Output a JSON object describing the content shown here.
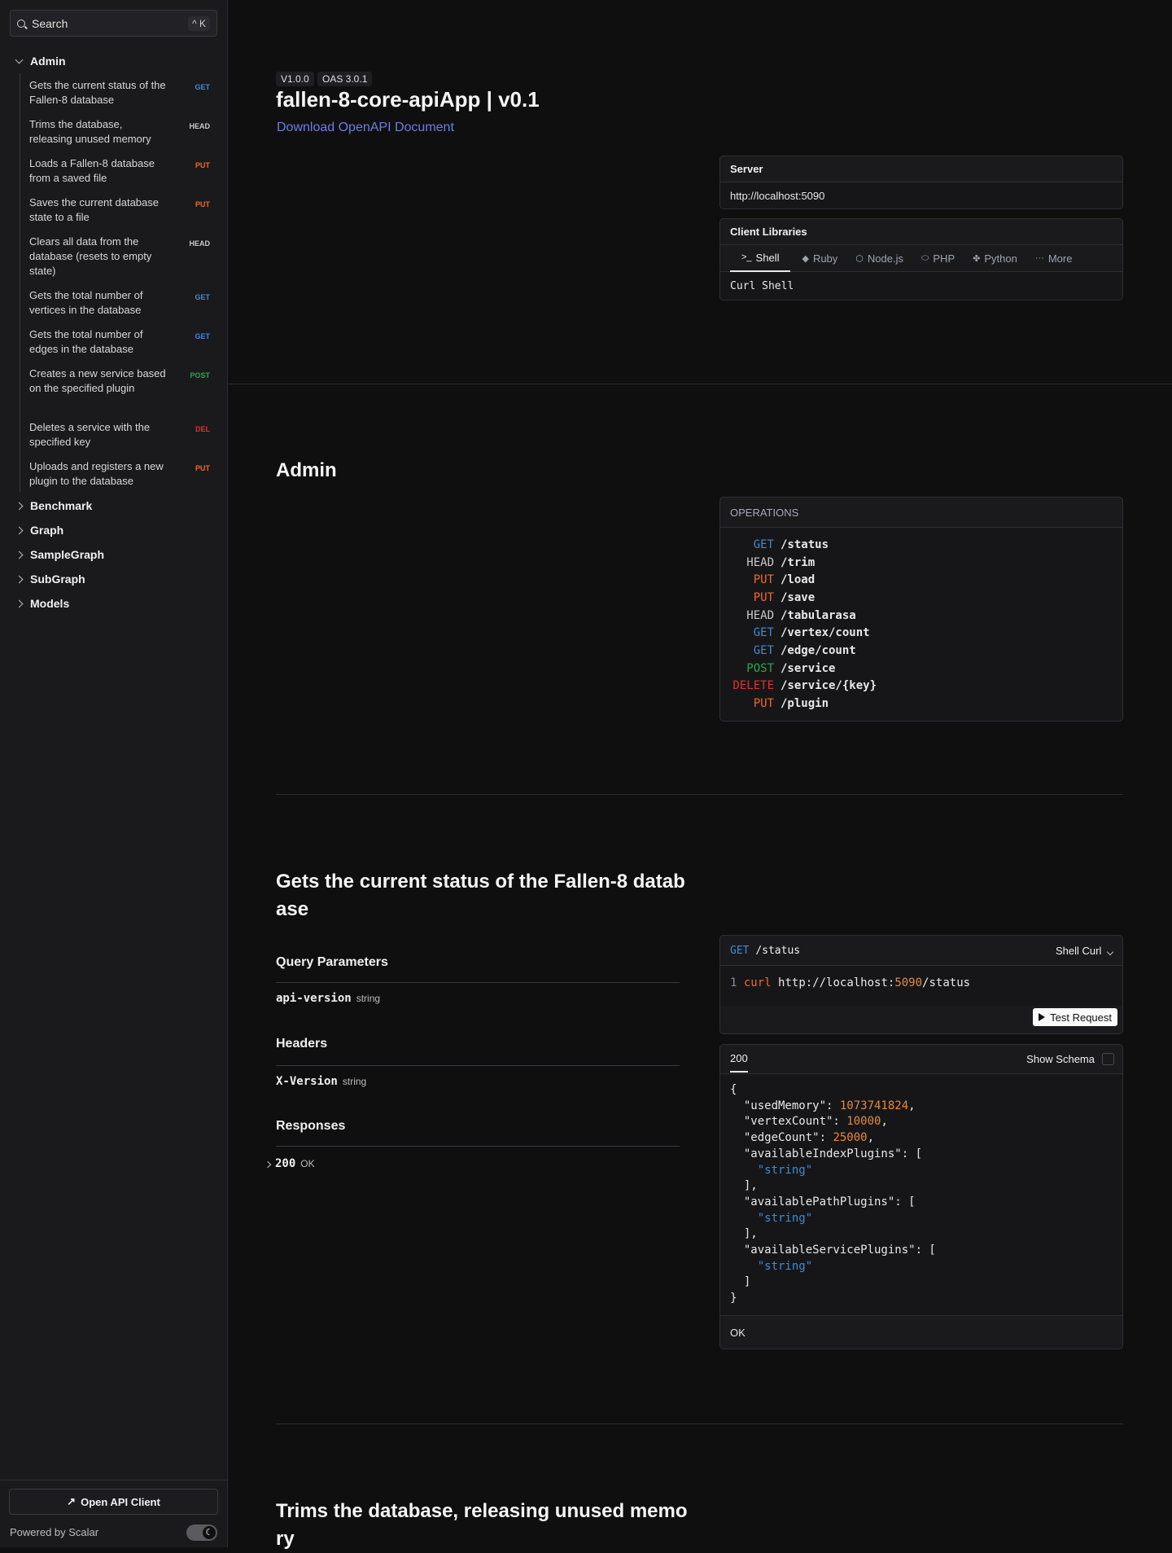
{
  "search": {
    "placeholder": "Search",
    "shortcut": "^ K"
  },
  "sidebar": {
    "admin_label": "Admin",
    "admin_items": [
      {
        "label": "Gets the current status of the Fallen-8 database",
        "method": "GET"
      },
      {
        "label": "Trims the database, releasing unused memory",
        "method": "HEAD"
      },
      {
        "label": "Loads a Fallen-8 database from a saved file",
        "method": "PUT"
      },
      {
        "label": "Saves the current database state to a file",
        "method": "PUT"
      },
      {
        "label": "Clears all data from the database (resets to empty state)",
        "method": "HEAD"
      },
      {
        "label": "Gets the total number of vertices in the database",
        "method": "GET"
      },
      {
        "label": "Gets the total number of edges in the database",
        "method": "GET"
      },
      {
        "label": "Creates a new service based on the specified plugin",
        "method": "POST"
      },
      {
        "label": "Deletes a service with the specified key",
        "method": "DEL"
      },
      {
        "label": "Uploads and registers a new plugin to the database",
        "method": "PUT"
      }
    ],
    "groups": [
      "Benchmark",
      "Graph",
      "SampleGraph",
      "SubGraph",
      "Models"
    ],
    "open_client": "Open API Client",
    "powered_by": "Powered by Scalar"
  },
  "header": {
    "version": "V1.0.0",
    "oas": "OAS 3.0.1",
    "title": "fallen-8-core-apiApp | v0.1",
    "download": "Download OpenAPI Document"
  },
  "server": {
    "label": "Server",
    "url": "http://localhost:5090"
  },
  "client_libraries": {
    "label": "Client Libraries",
    "tabs": [
      "Shell",
      "Ruby",
      "Node.js",
      "PHP",
      "Python",
      "More"
    ],
    "selected": "Curl Shell"
  },
  "admin_section": {
    "title": "Admin",
    "operations_label": "OPERATIONS",
    "operations": [
      {
        "method": "GET",
        "path": "/status"
      },
      {
        "method": "HEAD",
        "path": "/trim"
      },
      {
        "method": "PUT",
        "path": "/load"
      },
      {
        "method": "PUT",
        "path": "/save"
      },
      {
        "method": "HEAD",
        "path": "/tabularasa"
      },
      {
        "method": "GET",
        "path": "/vertex/count"
      },
      {
        "method": "GET",
        "path": "/edge/count"
      },
      {
        "method": "POST",
        "path": "/service"
      },
      {
        "method": "DELETE",
        "path": "/service/{key}"
      },
      {
        "method": "PUT",
        "path": "/plugin"
      }
    ]
  },
  "status_endpoint": {
    "title_line1": "Gets the current status of the Fallen-8 datab",
    "title_line2": "ase",
    "query_params_label": "Query Parameters",
    "query_param_name": "api-version",
    "query_param_type": "string",
    "headers_label": "Headers",
    "header_name": "X-Version",
    "header_type": "string",
    "responses_label": "Responses",
    "response_code": "200",
    "response_text": "OK",
    "request": {
      "method": "GET",
      "path": "/status",
      "lang": "Shell Curl",
      "line_no": "1",
      "cmd": "curl",
      "url_host": "http://localhost:",
      "url_port": "5090",
      "url_path": "/status",
      "test_label": "Test Request"
    },
    "response_card": {
      "code": "200",
      "show_schema": "Show Schema",
      "body": {
        "usedMemory": "1073741824",
        "vertexCount": "10000",
        "edgeCount": "25000",
        "string_value": "\"string\""
      },
      "footer": "OK"
    }
  },
  "trim_endpoint": {
    "title_line1": "Trims the database, releasing unused memo",
    "title_line2": "ry"
  }
}
